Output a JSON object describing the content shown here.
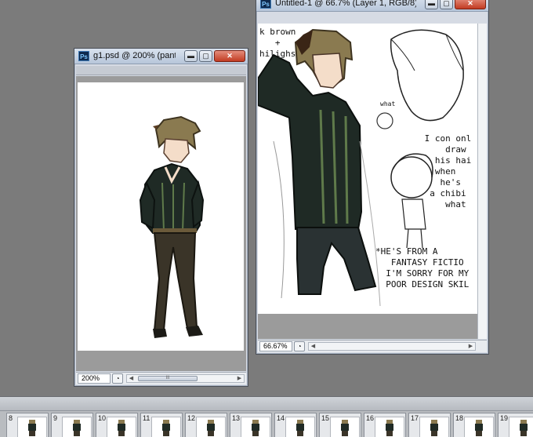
{
  "windows": {
    "g1": {
      "title": "g1.psd @ 200% (pant...",
      "zoom": "200%",
      "scroll_thumb": "III"
    },
    "untitled": {
      "title": "Untitled-1 @ 66.7% (Layer 1, RGB/8) *",
      "zoom": "66.67%"
    }
  },
  "controls": {
    "minimize": "▬",
    "maximize": "▢",
    "close": "✕",
    "app_badge": "Ps",
    "scroll_left": "◀",
    "scroll_right": "▶",
    "status_icon": "◔"
  },
  "notes": {
    "brown": "k brown\n   +\nhilighs",
    "what": "what",
    "chibi": " I con onl\n     draw\n   his hai\n   when\n    he's\n  a chibi\n     what",
    "fantasy": "*HE'S FROM A\n   FANTASY FICTIO\n  I'M SORRY FOR MY\n  POOR DESIGN SKIL"
  },
  "filmstrip": {
    "frames": [
      "8",
      "9",
      "10",
      "11",
      "12",
      "13",
      "14",
      "15",
      "16",
      "17",
      "18",
      "19"
    ]
  },
  "colors": {
    "workspace": "#7b7b7b",
    "hair": "#8a7a50",
    "shirt": "#1f2a25",
    "stripe": "#5f7a4a",
    "pants": "#3a3428"
  }
}
